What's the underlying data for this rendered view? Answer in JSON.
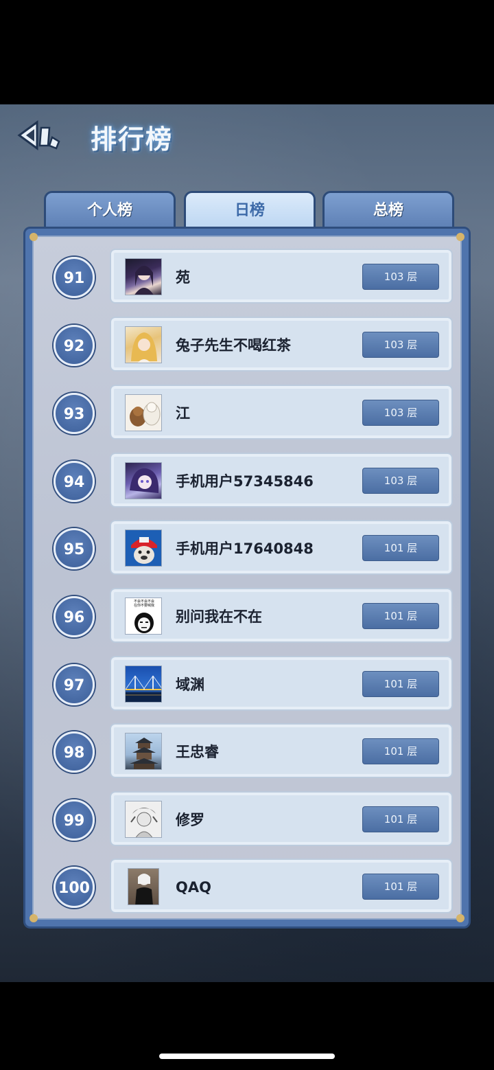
{
  "header": {
    "title": "排行榜"
  },
  "tabs": [
    {
      "label": "个人榜",
      "active": false
    },
    {
      "label": "日榜",
      "active": true
    },
    {
      "label": "总榜",
      "active": false
    }
  ],
  "leaderboard": [
    {
      "rank": "91",
      "name": "苑",
      "floor": "103 层",
      "avatar": "anime-girl-avatar"
    },
    {
      "rank": "92",
      "name": "兔子先生不喝红茶",
      "floor": "103 层",
      "avatar": "blonde-anime-avatar"
    },
    {
      "rank": "93",
      "name": "江",
      "floor": "103 层",
      "avatar": "dogs-avatar"
    },
    {
      "rank": "94",
      "name": "手机用户57345846",
      "floor": "103 层",
      "avatar": "anime-character-avatar"
    },
    {
      "rank": "95",
      "name": "手机用户17640848",
      "floor": "101 层",
      "avatar": "cartoon-dog-avatar"
    },
    {
      "rank": "96",
      "name": "别问我在不在",
      "floor": "101 层",
      "avatar": "meme-face-avatar"
    },
    {
      "rank": "97",
      "name": "域渊",
      "floor": "101 层",
      "avatar": "bridge-night-avatar"
    },
    {
      "rank": "98",
      "name": "王忠睿",
      "floor": "101 层",
      "avatar": "pagoda-avatar"
    },
    {
      "rank": "99",
      "name": "修罗",
      "floor": "101 层",
      "avatar": "sketch-character-avatar"
    },
    {
      "rank": "100",
      "name": "QAQ",
      "floor": "101 层",
      "avatar": "person-photo-avatar"
    }
  ],
  "avatar_meme_text": "不会不会不会\n在你不要喊我",
  "colors": {
    "panel": "#4f74ad",
    "rank_badge": "#3c5f99",
    "card": "#d6e2ef",
    "tab_active": "#dbeafa"
  }
}
